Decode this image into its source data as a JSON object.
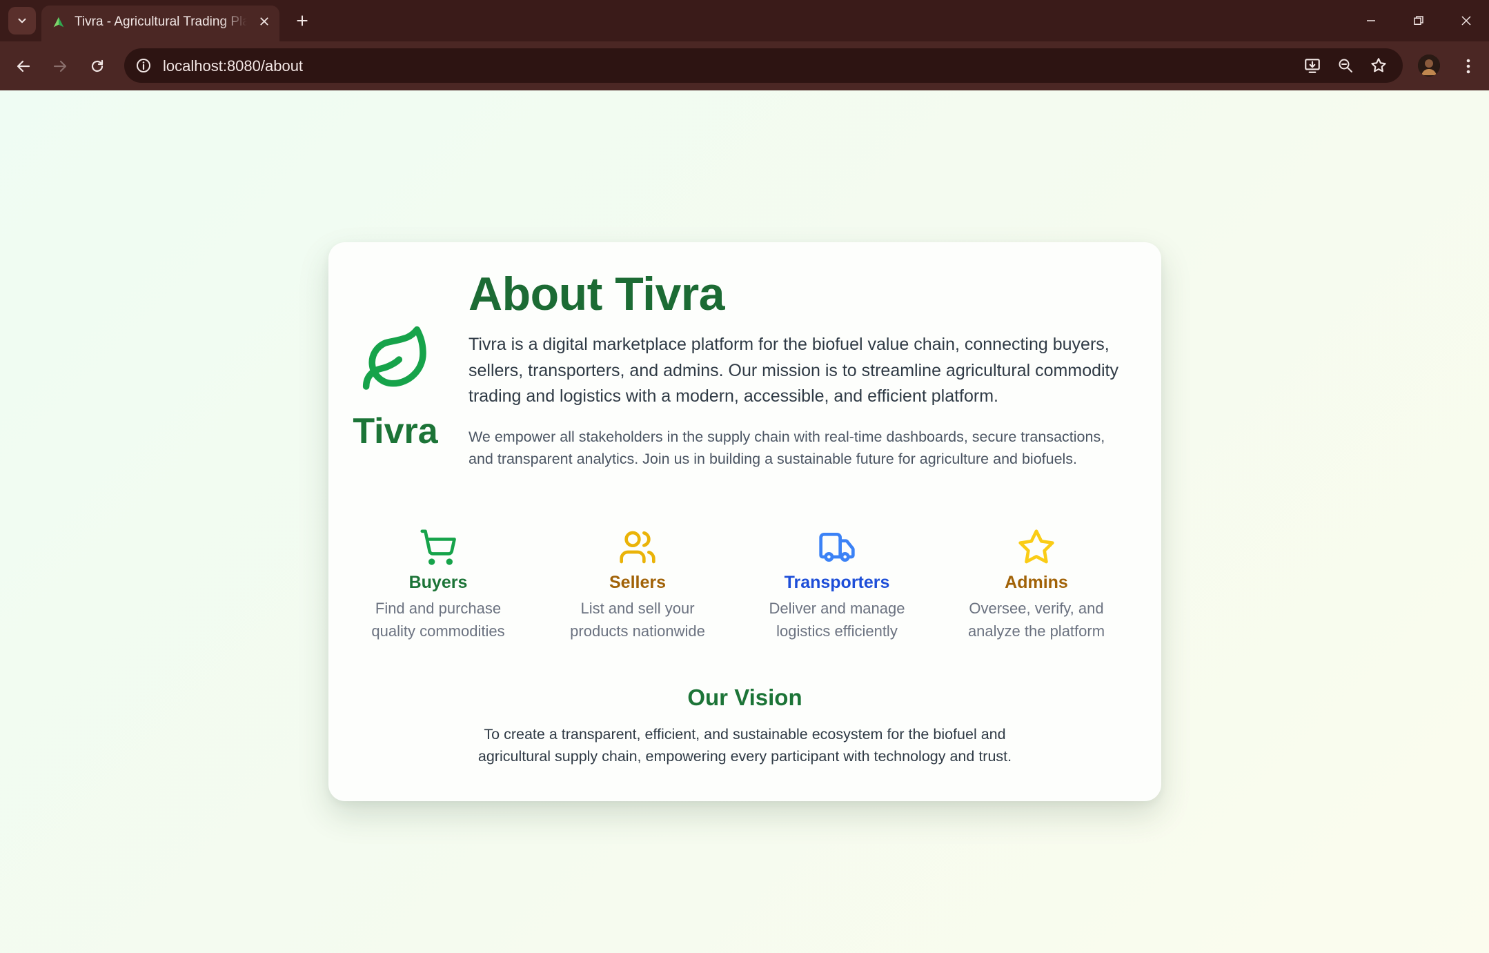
{
  "browser": {
    "tab_title": "Tivra - Agricultural Trading Platform",
    "url": "localhost:8080/about"
  },
  "brand": {
    "name": "Tivra",
    "icon": "leaf-icon",
    "color": "#16a34a"
  },
  "about": {
    "title": "About Tivra",
    "lead": "Tivra is a digital marketplace platform for the biofuel value chain, connecting buyers, sellers, transporters, and admins. Our mission is to streamline agricultural commodity trading and logistics with a modern, accessible, and efficient platform.",
    "sub": "We empower all stakeholders in the supply chain with real-time dashboards, secure transactions, and transparent analytics. Join us in building a sustainable future for agriculture and biofuels."
  },
  "roles": [
    {
      "name": "Buyers",
      "desc": "Find and purchase quality commodities",
      "icon": "shopping-cart-icon",
      "color": "#16a34a",
      "name_color": "#1c7437"
    },
    {
      "name": "Sellers",
      "desc": "List and sell your products nationwide",
      "icon": "users-icon",
      "color": "#eab308",
      "name_color": "#a16207"
    },
    {
      "name": "Transporters",
      "desc": "Deliver and manage logistics efficiently",
      "icon": "truck-icon",
      "color": "#3b82f6",
      "name_color": "#1d4ed8"
    },
    {
      "name": "Admins",
      "desc": "Oversee, verify, and analyze the platform",
      "icon": "star-icon",
      "color": "#facc15",
      "name_color": "#a16207"
    }
  ],
  "vision": {
    "title": "Our Vision",
    "text": "To create a transparent, efficient, and sustainable ecosystem for the biofuel and agricultural supply chain, empowering every participant with technology and trust."
  }
}
